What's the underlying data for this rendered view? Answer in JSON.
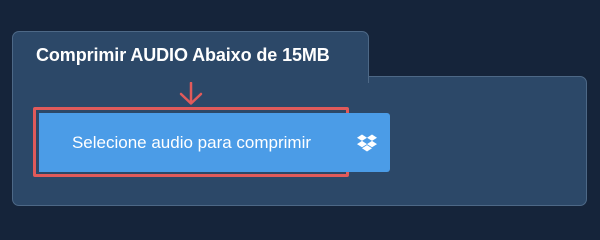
{
  "tab": {
    "title": "Comprimir AUDIO Abaixo de 15MB"
  },
  "upload": {
    "select_label": "Selecione audio para comprimir",
    "dropbox_icon": "dropbox-icon"
  },
  "colors": {
    "page_background": "#15243a",
    "panel_background": "#2c4868",
    "button_blue": "#4b9ce7",
    "highlight_red": "#e15a5a"
  }
}
